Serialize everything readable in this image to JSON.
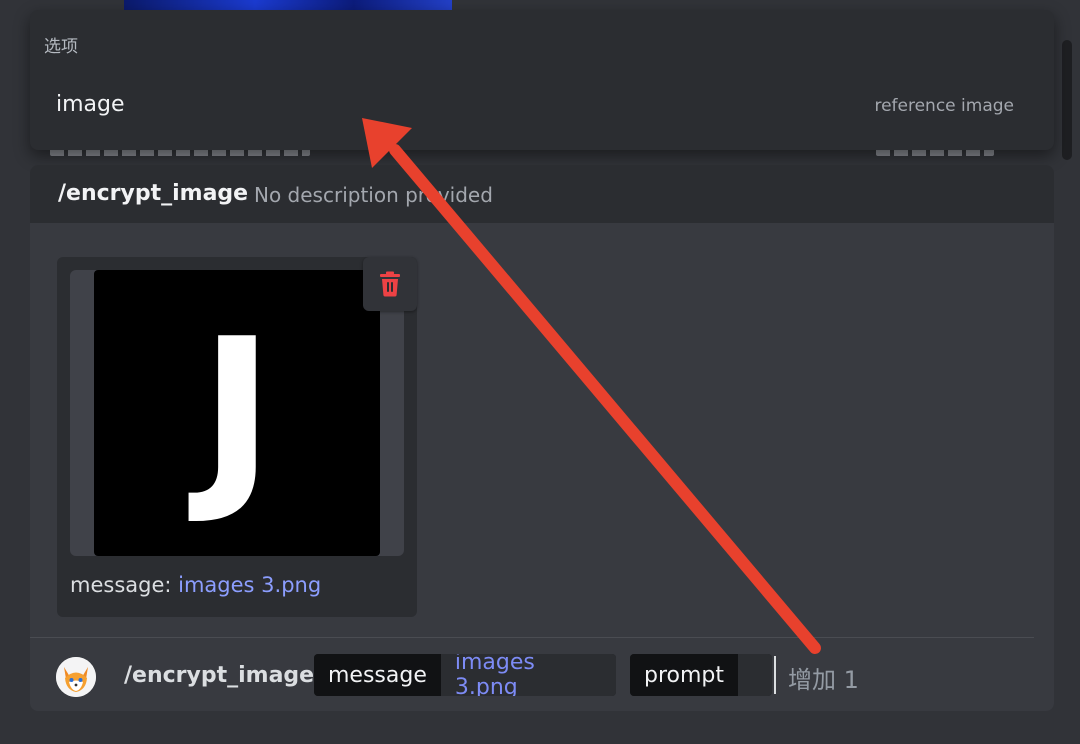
{
  "options": {
    "header": "选项",
    "items": [
      {
        "name": "image",
        "description": "reference image"
      }
    ]
  },
  "command": {
    "title": "/encrypt_image",
    "subtitle": "No description provided"
  },
  "attachment": {
    "preview_letter": "J",
    "caption_label": "message:",
    "filename": "images 3.png"
  },
  "input": {
    "command": "/encrypt_image",
    "params": [
      {
        "key": "message",
        "value": "images 3.png"
      },
      {
        "key": "prompt",
        "value": ""
      }
    ],
    "increase_label": "增加 1"
  },
  "colors": {
    "background": "#313338",
    "panel": "#383a40",
    "popup": "#2b2d31",
    "link": "#8c9eff",
    "danger": "#ed4245",
    "annotation_arrow": "#e8412d"
  },
  "icons": [
    "trash-icon",
    "bot-avatar-fox"
  ]
}
